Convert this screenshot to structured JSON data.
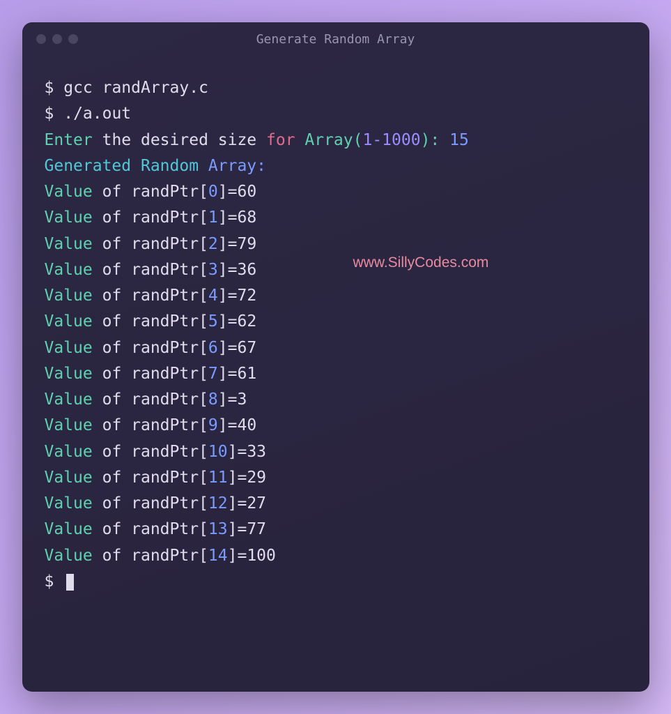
{
  "window": {
    "title": "Generate Random Array"
  },
  "terminal": {
    "prompt": "$",
    "cmd1": "gcc randArray.c",
    "cmd2": "./a.out",
    "enter_prefix": "Enter",
    "enter_mid": " the desired size ",
    "for_word": "for",
    "array_label": " Array(",
    "range": "1-1000",
    "close_colon": "): ",
    "input_value": "15",
    "gen_prefix": "Generated Random ",
    "array_word": "Array:",
    "value_word": "Value",
    "of_word": " of ",
    "randptr_word": "randPtr[",
    "close_eq": "]=",
    "rows": [
      {
        "idx": "0",
        "val": "60"
      },
      {
        "idx": "1",
        "val": "68"
      },
      {
        "idx": "2",
        "val": "79"
      },
      {
        "idx": "3",
        "val": "36"
      },
      {
        "idx": "4",
        "val": "72"
      },
      {
        "idx": "5",
        "val": "62"
      },
      {
        "idx": "6",
        "val": "67"
      },
      {
        "idx": "7",
        "val": "61"
      },
      {
        "idx": "8",
        "val": "3"
      },
      {
        "idx": "9",
        "val": "40"
      },
      {
        "idx": "10",
        "val": "33"
      },
      {
        "idx": "11",
        "val": "29"
      },
      {
        "idx": "12",
        "val": "27"
      },
      {
        "idx": "13",
        "val": "77"
      },
      {
        "idx": "14",
        "val": "100"
      }
    ]
  },
  "watermark": "www.SillyCodes.com"
}
